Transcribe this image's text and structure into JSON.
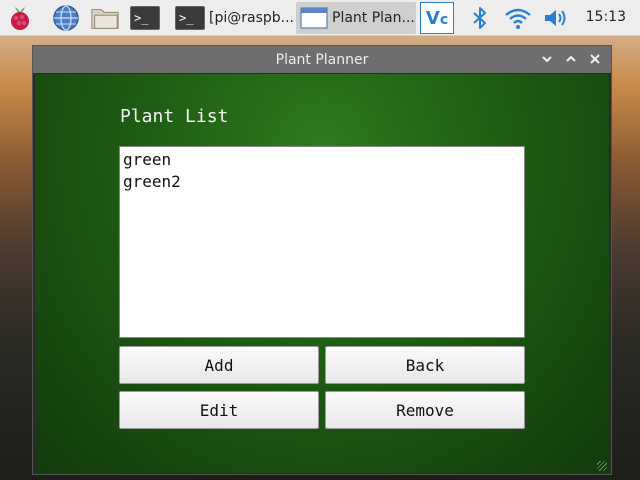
{
  "taskbar": {
    "icons": {
      "menu": "raspberry-icon",
      "browser": "globe-icon",
      "files": "folder-icon",
      "terminal": "terminal-icon"
    },
    "tasks": [
      {
        "label": "[pi@raspb...",
        "icon": "terminal-icon"
      },
      {
        "label": "Plant Plan...",
        "icon": "window-icon"
      }
    ],
    "tray": {
      "vnc": "vnc-icon",
      "bluetooth": "bluetooth-icon",
      "wifi": "wifi-icon",
      "volume": "volume-icon"
    },
    "clock": "15:13"
  },
  "window": {
    "title": "Plant Planner",
    "controls": [
      "minimize",
      "maximize",
      "close"
    ]
  },
  "main": {
    "heading": "Plant List",
    "plants": [
      "green",
      "green2"
    ],
    "buttons": {
      "add": "Add",
      "back": "Back",
      "edit": "Edit",
      "remove": "Remove"
    }
  },
  "colors": {
    "taskbar_bg": "#ededed",
    "titlebar_bg": "#6e6e6e",
    "content_green": "#1f5c14",
    "accent_blue": "#2a7fd4"
  }
}
